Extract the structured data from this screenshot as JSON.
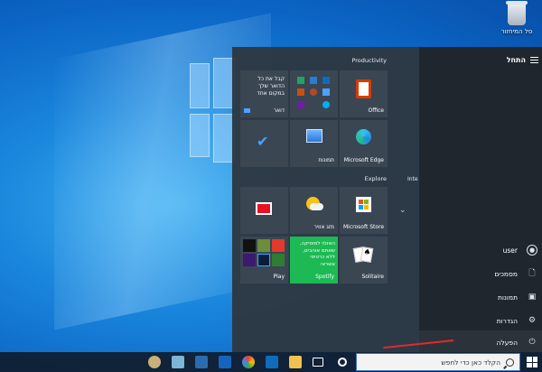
{
  "desktop": {
    "recycle_bin_label": "סל המיחזור"
  },
  "start_menu": {
    "title": "התחל",
    "groups": {
      "productivity": "Productivity",
      "explore": "Explore",
      "inte_cut": "Inte"
    },
    "tiles": {
      "office": "Office",
      "mail_text": "קבל את כל הדואר שלך במקום אחד",
      "mail_label": "דואר",
      "edge": "Microsoft Edge",
      "photos": "תמונות",
      "store": "Microsoft Store",
      "weather": "מזג אוויר",
      "spotify_text": "האזנ/י למוסיקה, שאתם אוהבים, ללא כרטיסי אשראי.",
      "spotify_label": "Spotify",
      "play": "Play",
      "solitaire": "Solitaire"
    },
    "nav": {
      "user": "user",
      "documents": "מסמכים",
      "pictures": "תמונות",
      "settings": "הגדרות",
      "power": "הפעלה"
    }
  },
  "taskbar": {
    "search_placeholder": "הקלד כאן כדי לחפש"
  },
  "colors": {
    "accent": "#0078d7",
    "spotify_green": "#1db954",
    "highlight_arrow": "#e22b2b"
  }
}
